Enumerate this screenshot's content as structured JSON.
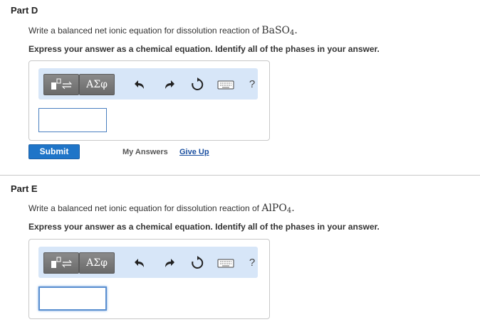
{
  "part_d": {
    "title": "Part D",
    "prompt_text": "Write a balanced net ionic equation for dissolution reaction of ",
    "formula_main": "BaSO",
    "formula_sub": "4",
    "formula_end": ".",
    "instruction": "Express your answer as a chemical equation. Identify all of the phases in your answer.",
    "toolbar": {
      "greek_label": "ΑΣφ",
      "help_label": "?"
    },
    "answer_value": "",
    "submit_label": "Submit",
    "my_answers_label": "My Answers",
    "give_up_label": "Give Up"
  },
  "part_e": {
    "title": "Part E",
    "prompt_text": "Write a balanced net ionic equation for dissolution reaction of ",
    "formula_main": "AlPO",
    "formula_sub": "4",
    "formula_end": ".",
    "instruction": "Express your answer as a chemical equation. Identify all of the phases in your answer.",
    "toolbar": {
      "greek_label": "ΑΣφ",
      "help_label": "?"
    },
    "answer_value": ""
  },
  "icons": [
    "template-icon",
    "greek-letters-icon",
    "undo-icon",
    "redo-icon",
    "reset-icon",
    "keyboard-icon",
    "help-icon"
  ],
  "colors": {
    "toolbar_bg": "#d7e6f8",
    "submit_bg": "#1f75c8",
    "link": "#1a4fa0"
  }
}
